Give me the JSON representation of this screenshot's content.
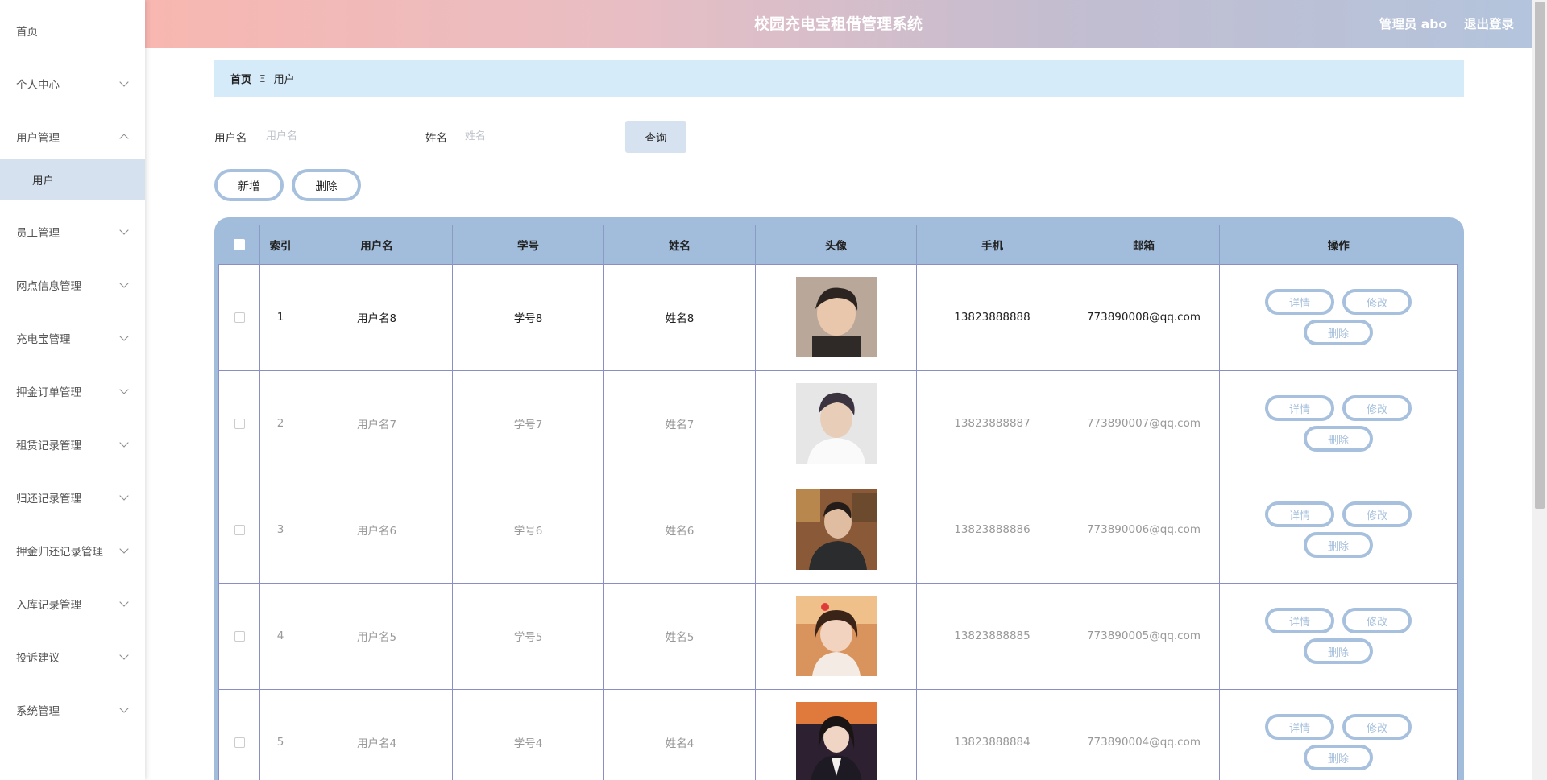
{
  "header": {
    "title": "校园充电宝租借管理系统",
    "user": "管理员 abo",
    "logout": "退出登录"
  },
  "sidebar": {
    "items": [
      {
        "label": "首页"
      },
      {
        "label": "个人中心"
      },
      {
        "label": "用户管理"
      },
      {
        "label": "用户"
      },
      {
        "label": "员工管理"
      },
      {
        "label": "网点信息管理"
      },
      {
        "label": "充电宝管理"
      },
      {
        "label": "押金订单管理"
      },
      {
        "label": "租赁记录管理"
      },
      {
        "label": "归还记录管理"
      },
      {
        "label": "押金归还记录管理"
      },
      {
        "label": "入库记录管理"
      },
      {
        "label": "投诉建议"
      },
      {
        "label": "系统管理"
      }
    ]
  },
  "breadcrumb": {
    "home": "首页",
    "separator": "Ξ",
    "current": "用户"
  },
  "search": {
    "username_label": "用户名",
    "username_placeholder": "用户名",
    "name_label": "姓名",
    "name_placeholder": "姓名",
    "query_label": "查询"
  },
  "actions": {
    "add_label": "新增",
    "delete_label": "删除"
  },
  "table": {
    "headers": [
      "索引",
      "用户名",
      "学号",
      "姓名",
      "头像",
      "手机",
      "邮箱",
      "操作"
    ],
    "op_labels": {
      "detail": "详情",
      "edit": "修改",
      "delete": "删除"
    },
    "rows": [
      {
        "index": "1",
        "username": "用户名8",
        "student_no": "学号8",
        "name": "姓名8",
        "avatar": "avatar-photo-boy-dark-hair",
        "phone": "13823888888",
        "email": "773890008@qq.com"
      },
      {
        "index": "2",
        "username": "用户名7",
        "student_no": "学号7",
        "name": "姓名7",
        "avatar": "avatar-photo-boy-white-hoodie",
        "phone": "13823888887",
        "email": "773890007@qq.com"
      },
      {
        "index": "3",
        "username": "用户名6",
        "student_no": "学号6",
        "name": "姓名6",
        "avatar": "avatar-photo-man-suit",
        "phone": "13823888886",
        "email": "773890006@qq.com"
      },
      {
        "index": "4",
        "username": "用户名5",
        "student_no": "学号5",
        "name": "姓名5",
        "avatar": "avatar-photo-girl-smiling",
        "phone": "13823888885",
        "email": "773890005@qq.com"
      },
      {
        "index": "5",
        "username": "用户名4",
        "student_no": "学号4",
        "name": "姓名4",
        "avatar": "avatar-photo-girl-sunset",
        "phone": "13823888884",
        "email": "773890004@qq.com"
      }
    ]
  },
  "colors": {
    "accent": "#a2bddb",
    "breadcrumb_bg": "#d6ebfa",
    "active_menu_bg": "#d5e1ef",
    "button_border": "#a6c0dd"
  }
}
